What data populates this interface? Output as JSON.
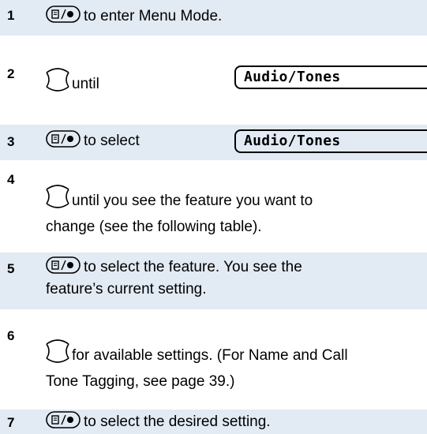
{
  "colors": {
    "band": "#e2eaf3"
  },
  "icons": {
    "menu_key": "menu-select-key-icon",
    "scroll": "scroll-up-down-icon"
  },
  "steps": [
    {
      "num": "1",
      "text": "to enter Menu Mode."
    },
    {
      "num": "2",
      "text": "until",
      "display": "Audio/Tones"
    },
    {
      "num": "3",
      "text": "to select",
      "display": "Audio/Tones"
    },
    {
      "num": "4",
      "text_line1": "until you see the feature you want to",
      "text_line2": "change (see the following table)."
    },
    {
      "num": "5",
      "text_line1": "to select the feature. You see the",
      "text_line2": "feature’s current setting."
    },
    {
      "num": "6",
      "text_line1": "for available settings. (For Name and Call",
      "text_line2": "Tone Tagging, see page 39.)"
    },
    {
      "num": "7",
      "text": "to select the desired setting."
    }
  ]
}
